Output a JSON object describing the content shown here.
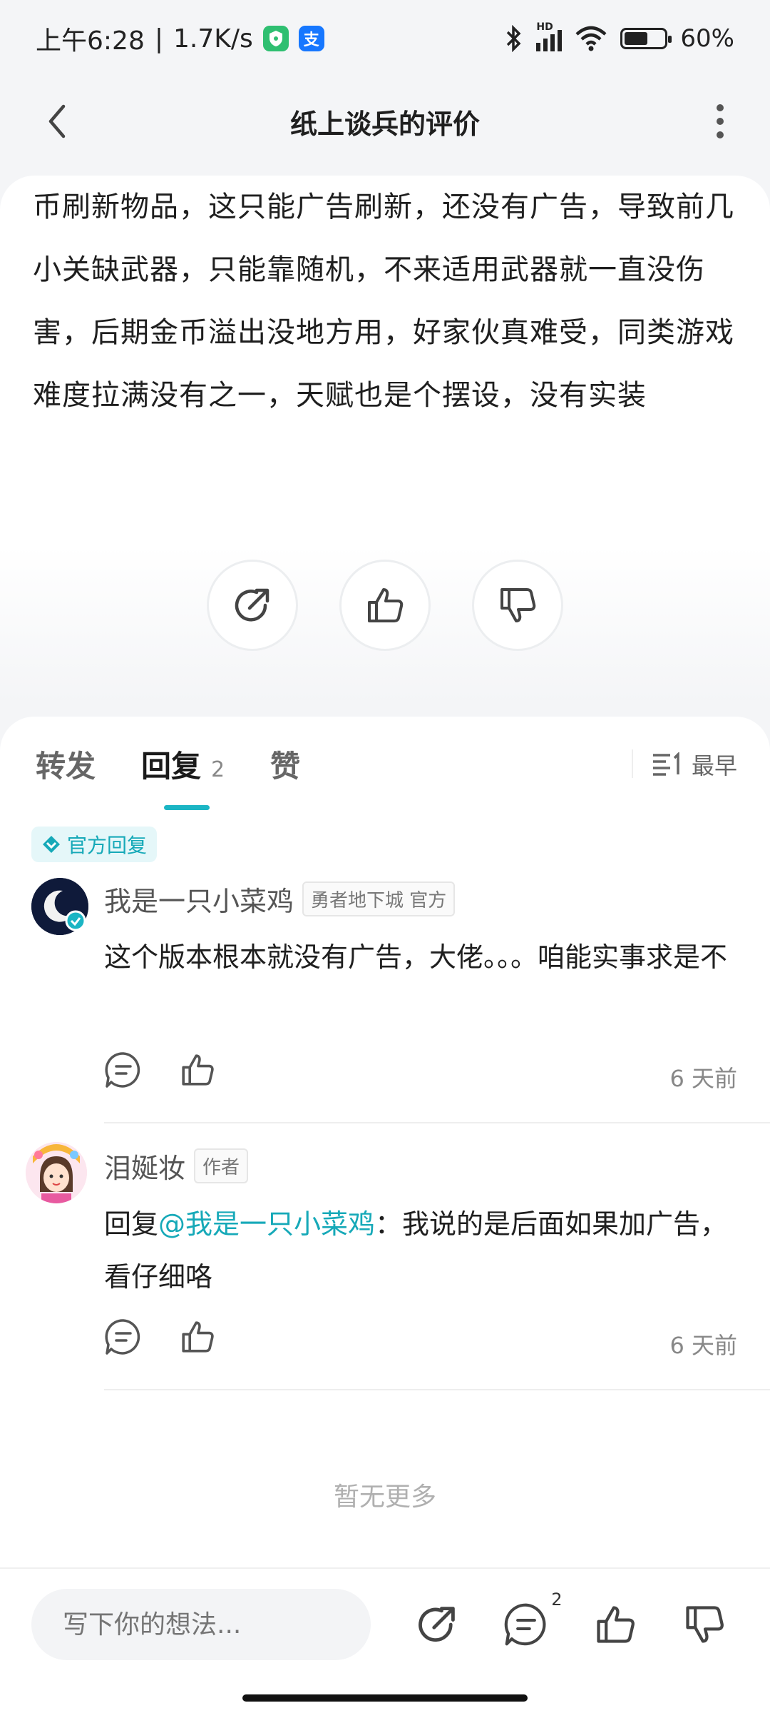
{
  "status_bar": {
    "time": "上午6:28",
    "speed": "1.7K/s",
    "battery": "60%",
    "battery_level": 0.6,
    "alipay_glyph": "支",
    "hd_label": "HD"
  },
  "nav": {
    "title": "纸上谈兵的评价"
  },
  "review": {
    "text": "币刷新物品，这只能广告刷新，还没有广告，导致前几小关缺武器，只能靠随机，不来适用武器就一直没伤害，后期金币溢出没地方用，好家伙真难受，同类游戏难度拉满没有之一，天赋也是个摆设，没有实装"
  },
  "tabs": {
    "forward": "转发",
    "reply": "回复",
    "reply_count": "2",
    "like": "赞",
    "sort": "最早"
  },
  "official_tag": "官方回复",
  "comments": [
    {
      "name": "我是一只小菜鸡",
      "tag": "勇者地下城 官方",
      "body": "这个版本根本就没有广告，大佬。。。咱能实事求是不",
      "time": "6 天前"
    },
    {
      "name": "泪娫妆",
      "tag": "作者",
      "reply_prefix": "回复",
      "mention": "@我是一只小菜鸡",
      "body": "：我说的是后面如果加广告，看仔细咯",
      "time": "6 天前"
    }
  ],
  "no_more": "暂无更多",
  "composer": {
    "placeholder": "写下你的想法..."
  },
  "bottom_counts": {
    "comments": "2"
  },
  "colors": {
    "accent": "#1bb5c4",
    "mention": "#16a9b8"
  }
}
